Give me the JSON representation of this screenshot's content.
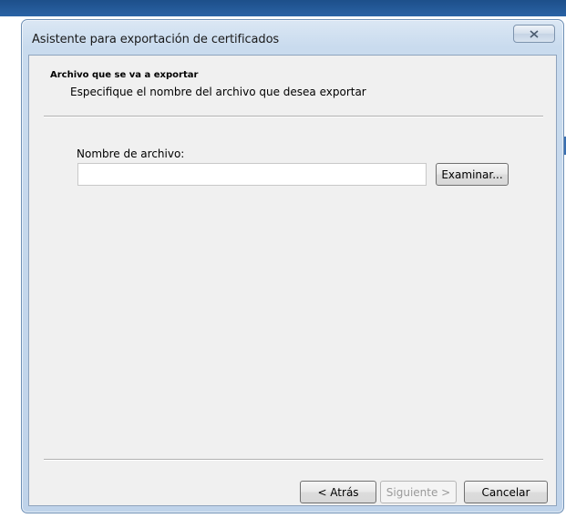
{
  "window": {
    "title": "Asistente para exportación de certificados"
  },
  "header": {
    "title": "Archivo que se va a exportar",
    "subtitle": "Especifique el nombre del archivo que desea exportar"
  },
  "form": {
    "filename_label": "Nombre de archivo:",
    "filename_value": "",
    "browse_label": "Examinar..."
  },
  "footer": {
    "back_label": "< Atrás",
    "next_label": "Siguiente >",
    "cancel_label": "Cancelar"
  },
  "icons": {
    "close": "close-icon"
  },
  "colors": {
    "titlebar": "#c9dbee",
    "client_background": "#f0f0f0",
    "disabled_text": "#9a9a9a"
  }
}
